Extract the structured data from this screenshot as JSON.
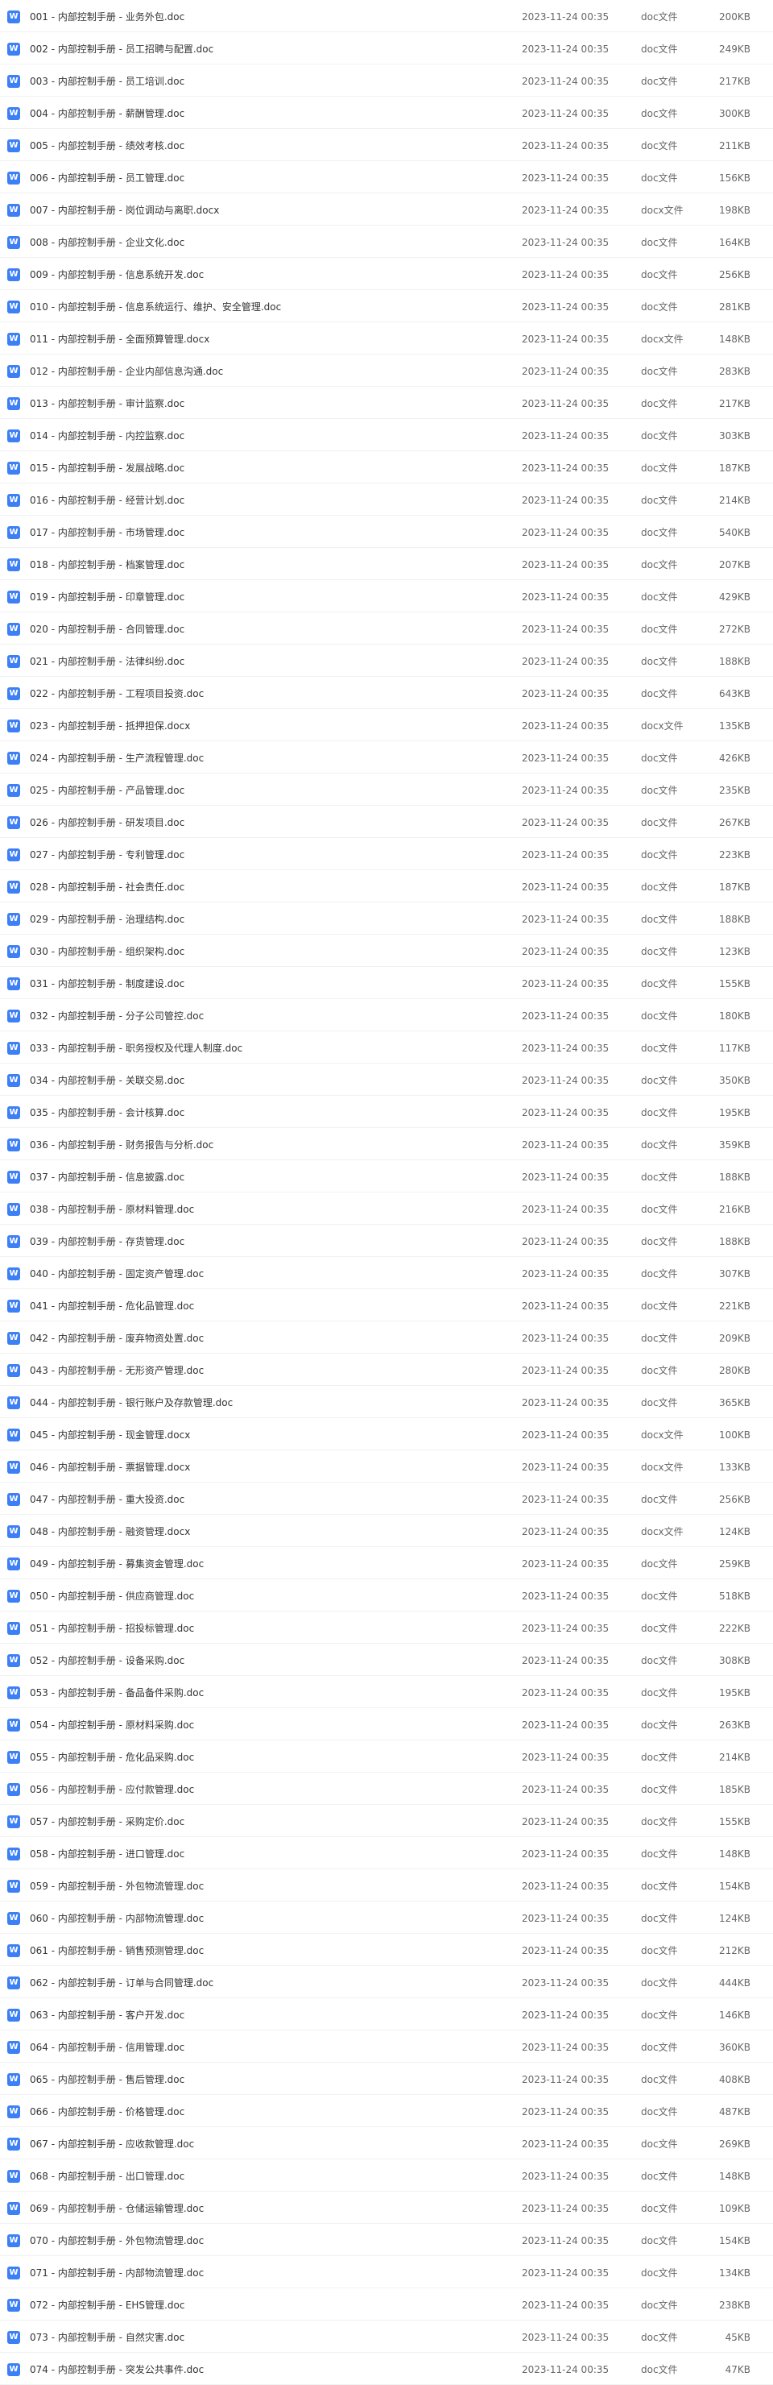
{
  "icon": {
    "name": "word-doc-icon",
    "glyph": "W",
    "color": "#3d7ff5"
  },
  "files": [
    {
      "name": "001 - 内部控制手册 - 业务外包.doc",
      "date": "2023-11-24 00:35",
      "type": "doc文件",
      "size": "200KB"
    },
    {
      "name": "002 - 内部控制手册 - 员工招聘与配置.doc",
      "date": "2023-11-24 00:35",
      "type": "doc文件",
      "size": "249KB"
    },
    {
      "name": "003 - 内部控制手册 - 员工培训.doc",
      "date": "2023-11-24 00:35",
      "type": "doc文件",
      "size": "217KB"
    },
    {
      "name": "004 - 内部控制手册 - 薪酬管理.doc",
      "date": "2023-11-24 00:35",
      "type": "doc文件",
      "size": "300KB"
    },
    {
      "name": "005 - 内部控制手册 - 绩效考核.doc",
      "date": "2023-11-24 00:35",
      "type": "doc文件",
      "size": "211KB"
    },
    {
      "name": "006 - 内部控制手册 - 员工管理.doc",
      "date": "2023-11-24 00:35",
      "type": "doc文件",
      "size": "156KB"
    },
    {
      "name": "007 - 内部控制手册 - 岗位调动与离职.docx",
      "date": "2023-11-24 00:35",
      "type": "docx文件",
      "size": "198KB"
    },
    {
      "name": "008 - 内部控制手册 - 企业文化.doc",
      "date": "2023-11-24 00:35",
      "type": "doc文件",
      "size": "164KB"
    },
    {
      "name": "009 - 内部控制手册 - 信息系统开发.doc",
      "date": "2023-11-24 00:35",
      "type": "doc文件",
      "size": "256KB"
    },
    {
      "name": "010 - 内部控制手册 - 信息系统运行、维护、安全管理.doc",
      "date": "2023-11-24 00:35",
      "type": "doc文件",
      "size": "281KB"
    },
    {
      "name": "011 - 内部控制手册 - 全面预算管理.docx",
      "date": "2023-11-24 00:35",
      "type": "docx文件",
      "size": "148KB"
    },
    {
      "name": "012 - 内部控制手册 - 企业内部信息沟通.doc",
      "date": "2023-11-24 00:35",
      "type": "doc文件",
      "size": "283KB"
    },
    {
      "name": "013 - 内部控制手册 - 审计监察.doc",
      "date": "2023-11-24 00:35",
      "type": "doc文件",
      "size": "217KB"
    },
    {
      "name": "014 - 内部控制手册 - 内控监察.doc",
      "date": "2023-11-24 00:35",
      "type": "doc文件",
      "size": "303KB"
    },
    {
      "name": "015 - 内部控制手册 - 发展战略.doc",
      "date": "2023-11-24 00:35",
      "type": "doc文件",
      "size": "187KB"
    },
    {
      "name": "016 - 内部控制手册 - 经营计划.doc",
      "date": "2023-11-24 00:35",
      "type": "doc文件",
      "size": "214KB"
    },
    {
      "name": "017 - 内部控制手册 - 市场管理.doc",
      "date": "2023-11-24 00:35",
      "type": "doc文件",
      "size": "540KB"
    },
    {
      "name": "018 - 内部控制手册 - 档案管理.doc",
      "date": "2023-11-24 00:35",
      "type": "doc文件",
      "size": "207KB"
    },
    {
      "name": "019 - 内部控制手册 - 印章管理.doc",
      "date": "2023-11-24 00:35",
      "type": "doc文件",
      "size": "429KB"
    },
    {
      "name": "020 - 内部控制手册 - 合同管理.doc",
      "date": "2023-11-24 00:35",
      "type": "doc文件",
      "size": "272KB"
    },
    {
      "name": "021 - 内部控制手册 - 法律纠纷.doc",
      "date": "2023-11-24 00:35",
      "type": "doc文件",
      "size": "188KB"
    },
    {
      "name": "022 - 内部控制手册 - 工程项目投资.doc",
      "date": "2023-11-24 00:35",
      "type": "doc文件",
      "size": "643KB"
    },
    {
      "name": "023 - 内部控制手册 - 抵押担保.docx",
      "date": "2023-11-24 00:35",
      "type": "docx文件",
      "size": "135KB"
    },
    {
      "name": "024 - 内部控制手册 - 生产流程管理.doc",
      "date": "2023-11-24 00:35",
      "type": "doc文件",
      "size": "426KB"
    },
    {
      "name": "025 - 内部控制手册 - 产品管理.doc",
      "date": "2023-11-24 00:35",
      "type": "doc文件",
      "size": "235KB"
    },
    {
      "name": "026 - 内部控制手册 - 研发项目.doc",
      "date": "2023-11-24 00:35",
      "type": "doc文件",
      "size": "267KB"
    },
    {
      "name": "027 - 内部控制手册 - 专利管理.doc",
      "date": "2023-11-24 00:35",
      "type": "doc文件",
      "size": "223KB"
    },
    {
      "name": "028 - 内部控制手册 - 社会责任.doc",
      "date": "2023-11-24 00:35",
      "type": "doc文件",
      "size": "187KB"
    },
    {
      "name": "029 - 内部控制手册 - 治理结构.doc",
      "date": "2023-11-24 00:35",
      "type": "doc文件",
      "size": "188KB"
    },
    {
      "name": "030 - 内部控制手册 - 组织架构.doc",
      "date": "2023-11-24 00:35",
      "type": "doc文件",
      "size": "123KB"
    },
    {
      "name": "031 - 内部控制手册 - 制度建设.doc",
      "date": "2023-11-24 00:35",
      "type": "doc文件",
      "size": "155KB"
    },
    {
      "name": "032 - 内部控制手册 - 分子公司管控.doc",
      "date": "2023-11-24 00:35",
      "type": "doc文件",
      "size": "180KB"
    },
    {
      "name": "033 - 内部控制手册 - 职务授权及代理人制度.doc",
      "date": "2023-11-24 00:35",
      "type": "doc文件",
      "size": "117KB"
    },
    {
      "name": "034 - 内部控制手册 - 关联交易.doc",
      "date": "2023-11-24 00:35",
      "type": "doc文件",
      "size": "350KB"
    },
    {
      "name": "035 - 内部控制手册 - 会计核算.doc",
      "date": "2023-11-24 00:35",
      "type": "doc文件",
      "size": "195KB"
    },
    {
      "name": "036 - 内部控制手册 - 财务报告与分析.doc",
      "date": "2023-11-24 00:35",
      "type": "doc文件",
      "size": "359KB"
    },
    {
      "name": "037 - 内部控制手册 - 信息披露.doc",
      "date": "2023-11-24 00:35",
      "type": "doc文件",
      "size": "188KB"
    },
    {
      "name": "038 - 内部控制手册 - 原材料管理.doc",
      "date": "2023-11-24 00:35",
      "type": "doc文件",
      "size": "216KB"
    },
    {
      "name": "039 - 内部控制手册 - 存货管理.doc",
      "date": "2023-11-24 00:35",
      "type": "doc文件",
      "size": "188KB"
    },
    {
      "name": "040 - 内部控制手册 - 固定资产管理.doc",
      "date": "2023-11-24 00:35",
      "type": "doc文件",
      "size": "307KB"
    },
    {
      "name": "041 - 内部控制手册 - 危化品管理.doc",
      "date": "2023-11-24 00:35",
      "type": "doc文件",
      "size": "221KB"
    },
    {
      "name": "042 - 内部控制手册 - 废弃物资处置.doc",
      "date": "2023-11-24 00:35",
      "type": "doc文件",
      "size": "209KB"
    },
    {
      "name": "043 - 内部控制手册 - 无形资产管理.doc",
      "date": "2023-11-24 00:35",
      "type": "doc文件",
      "size": "280KB"
    },
    {
      "name": "044 - 内部控制手册 - 银行账户及存款管理.doc",
      "date": "2023-11-24 00:35",
      "type": "doc文件",
      "size": "365KB"
    },
    {
      "name": "045 - 内部控制手册 - 现金管理.docx",
      "date": "2023-11-24 00:35",
      "type": "docx文件",
      "size": "100KB"
    },
    {
      "name": "046 - 内部控制手册 - 票据管理.docx",
      "date": "2023-11-24 00:35",
      "type": "docx文件",
      "size": "133KB"
    },
    {
      "name": "047 - 内部控制手册 - 重大投资.doc",
      "date": "2023-11-24 00:35",
      "type": "doc文件",
      "size": "256KB"
    },
    {
      "name": "048 - 内部控制手册 - 融资管理.docx",
      "date": "2023-11-24 00:35",
      "type": "docx文件",
      "size": "124KB"
    },
    {
      "name": "049 - 内部控制手册 - 募集资金管理.doc",
      "date": "2023-11-24 00:35",
      "type": "doc文件",
      "size": "259KB"
    },
    {
      "name": "050 - 内部控制手册 - 供应商管理.doc",
      "date": "2023-11-24 00:35",
      "type": "doc文件",
      "size": "518KB"
    },
    {
      "name": "051 - 内部控制手册 - 招投标管理.doc",
      "date": "2023-11-24 00:35",
      "type": "doc文件",
      "size": "222KB"
    },
    {
      "name": "052 - 内部控制手册 - 设备采购.doc",
      "date": "2023-11-24 00:35",
      "type": "doc文件",
      "size": "308KB"
    },
    {
      "name": "053 - 内部控制手册 - 备品备件采购.doc",
      "date": "2023-11-24 00:35",
      "type": "doc文件",
      "size": "195KB"
    },
    {
      "name": "054 - 内部控制手册 - 原材料采购.doc",
      "date": "2023-11-24 00:35",
      "type": "doc文件",
      "size": "263KB"
    },
    {
      "name": "055 - 内部控制手册 - 危化品采购.doc",
      "date": "2023-11-24 00:35",
      "type": "doc文件",
      "size": "214KB"
    },
    {
      "name": "056 - 内部控制手册 - 应付款管理.doc",
      "date": "2023-11-24 00:35",
      "type": "doc文件",
      "size": "185KB"
    },
    {
      "name": "057 - 内部控制手册 - 采购定价.doc",
      "date": "2023-11-24 00:35",
      "type": "doc文件",
      "size": "155KB"
    },
    {
      "name": "058 - 内部控制手册 - 进口管理.doc",
      "date": "2023-11-24 00:35",
      "type": "doc文件",
      "size": "148KB"
    },
    {
      "name": "059 - 内部控制手册 - 外包物流管理.doc",
      "date": "2023-11-24 00:35",
      "type": "doc文件",
      "size": "154KB"
    },
    {
      "name": "060 - 内部控制手册 - 内部物流管理.doc",
      "date": "2023-11-24 00:35",
      "type": "doc文件",
      "size": "124KB"
    },
    {
      "name": "061 - 内部控制手册 - 销售预测管理.doc",
      "date": "2023-11-24 00:35",
      "type": "doc文件",
      "size": "212KB"
    },
    {
      "name": "062 - 内部控制手册 - 订单与合同管理.doc",
      "date": "2023-11-24 00:35",
      "type": "doc文件",
      "size": "444KB"
    },
    {
      "name": "063 - 内部控制手册 - 客户开发.doc",
      "date": "2023-11-24 00:35",
      "type": "doc文件",
      "size": "146KB"
    },
    {
      "name": "064 - 内部控制手册 - 信用管理.doc",
      "date": "2023-11-24 00:35",
      "type": "doc文件",
      "size": "360KB"
    },
    {
      "name": "065 - 内部控制手册 - 售后管理.doc",
      "date": "2023-11-24 00:35",
      "type": "doc文件",
      "size": "408KB"
    },
    {
      "name": "066 - 内部控制手册 - 价格管理.doc",
      "date": "2023-11-24 00:35",
      "type": "doc文件",
      "size": "487KB"
    },
    {
      "name": "067 - 内部控制手册 - 应收款管理.doc",
      "date": "2023-11-24 00:35",
      "type": "doc文件",
      "size": "269KB"
    },
    {
      "name": "068 - 内部控制手册 - 出口管理.doc",
      "date": "2023-11-24 00:35",
      "type": "doc文件",
      "size": "148KB"
    },
    {
      "name": "069 - 内部控制手册 - 仓储运输管理.doc",
      "date": "2023-11-24 00:35",
      "type": "doc文件",
      "size": "109KB"
    },
    {
      "name": "070 - 内部控制手册 - 外包物流管理.doc",
      "date": "2023-11-24 00:35",
      "type": "doc文件",
      "size": "154KB"
    },
    {
      "name": "071 - 内部控制手册 - 内部物流管理.doc",
      "date": "2023-11-24 00:35",
      "type": "doc文件",
      "size": "134KB"
    },
    {
      "name": "072 - 内部控制手册 - EHS管理.doc",
      "date": "2023-11-24 00:35",
      "type": "doc文件",
      "size": "238KB"
    },
    {
      "name": "073 - 内部控制手册 - 自然灾害.doc",
      "date": "2023-11-24 00:35",
      "type": "doc文件",
      "size": "45KB"
    },
    {
      "name": "074 - 内部控制手册 - 突发公共事件.doc",
      "date": "2023-11-24 00:35",
      "type": "doc文件",
      "size": "47KB"
    }
  ]
}
